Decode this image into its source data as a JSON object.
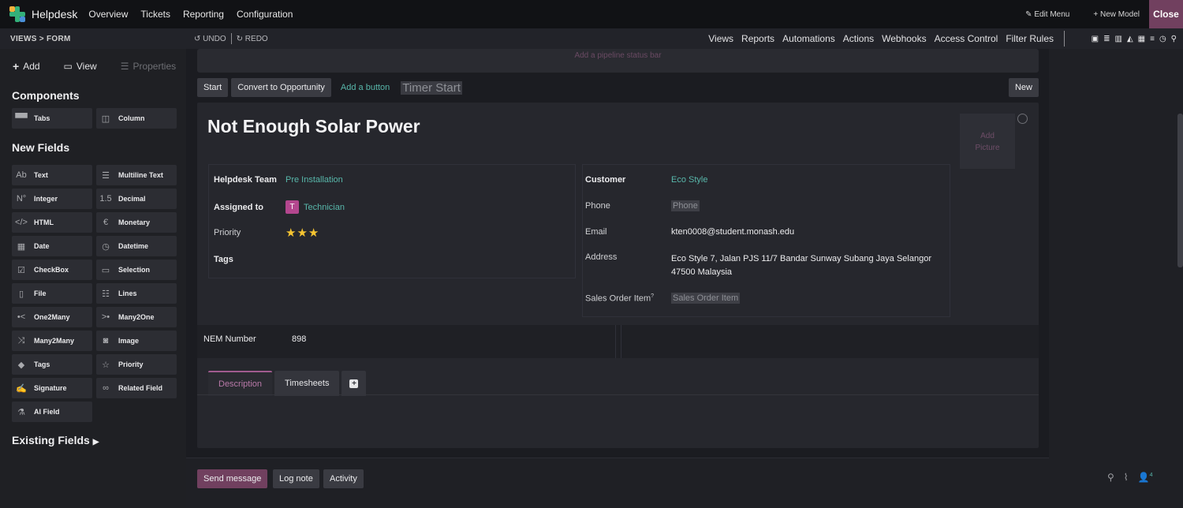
{
  "topnav": {
    "app": "Helpdesk",
    "menus": [
      "Overview",
      "Tickets",
      "Reporting",
      "Configuration"
    ],
    "edit_menu": "Edit Menu",
    "new_model": "+ New Model",
    "close": "Close"
  },
  "subbar": {
    "breadcrumb": "VIEWS > FORM",
    "undo": "UNDO",
    "redo": "REDO",
    "links": [
      "Views",
      "Reports",
      "Automations",
      "Actions",
      "Webhooks",
      "Access Control",
      "Filter Rules"
    ]
  },
  "sidebar": {
    "tabs": {
      "add": "Add",
      "view": "View",
      "properties": "Properties"
    },
    "components_title": "Components",
    "components": [
      {
        "label": "Tabs",
        "icon": "tabs-icon"
      },
      {
        "label": "Column",
        "icon": "column-icon"
      }
    ],
    "new_fields_title": "New Fields",
    "fields": [
      {
        "label": "Text",
        "icon": "text-icon"
      },
      {
        "label": "Multiline Text",
        "icon": "multiline-icon"
      },
      {
        "label": "Integer",
        "icon": "integer-icon"
      },
      {
        "label": "Decimal",
        "icon": "decimal-icon"
      },
      {
        "label": "HTML",
        "icon": "html-icon"
      },
      {
        "label": "Monetary",
        "icon": "monetary-icon"
      },
      {
        "label": "Date",
        "icon": "date-icon"
      },
      {
        "label": "Datetime",
        "icon": "datetime-icon"
      },
      {
        "label": "CheckBox",
        "icon": "checkbox-icon"
      },
      {
        "label": "Selection",
        "icon": "selection-icon"
      },
      {
        "label": "File",
        "icon": "file-icon"
      },
      {
        "label": "Lines",
        "icon": "lines-icon"
      },
      {
        "label": "One2Many",
        "icon": "one2many-icon"
      },
      {
        "label": "Many2One",
        "icon": "many2one-icon"
      },
      {
        "label": "Many2Many",
        "icon": "many2many-icon"
      },
      {
        "label": "Image",
        "icon": "image-icon"
      },
      {
        "label": "Tags",
        "icon": "tags-icon"
      },
      {
        "label": "Priority",
        "icon": "priority-icon"
      },
      {
        "label": "Signature",
        "icon": "signature-icon"
      },
      {
        "label": "Related Field",
        "icon": "related-field-icon"
      },
      {
        "label": "AI Field",
        "icon": "ai-field-icon"
      }
    ],
    "existing_fields": "Existing Fields"
  },
  "form": {
    "pipeline": "Add a pipeline status bar",
    "buttons": {
      "start": "Start",
      "convert": "Convert to Opportunity",
      "add_button": "Add a button",
      "timer": "Timer Start",
      "new": "New"
    },
    "title": "Not Enough Solar Power",
    "picture": {
      "line1": "Add",
      "line2": "Picture"
    },
    "left": {
      "team_label": "Helpdesk Team",
      "team_value": "Pre Installation",
      "assigned_label": "Assigned to",
      "assigned_initial": "T",
      "assigned_value": "Technician",
      "priority_label": "Priority",
      "priority_stars": 3,
      "tags_label": "Tags"
    },
    "right": {
      "customer_label": "Customer",
      "customer_value": "Eco Style",
      "phone_label": "Phone",
      "phone_placeholder": "Phone",
      "email_label": "Email",
      "email_value": "kten0008@student.monash.edu",
      "address_label": "Address",
      "address_line1": "Eco Style 7, Jalan PJS 11/7 Bandar Sunway Subang Jaya Selangor",
      "address_line2": "47500 Malaysia",
      "sales_label": "Sales Order Item",
      "sales_sup": "?",
      "sales_placeholder": "Sales Order Item"
    },
    "nem_label": "NEM Number",
    "nem_value": "898",
    "tabs": [
      "Description",
      "Timesheets"
    ]
  },
  "chatter": {
    "send": "Send message",
    "log": "Log note",
    "activity": "Activity",
    "followers": "4"
  },
  "colors": {
    "accent": "#71405f",
    "teal": "#58b7aa",
    "star": "#f5c431",
    "badge": "#b3468e"
  }
}
